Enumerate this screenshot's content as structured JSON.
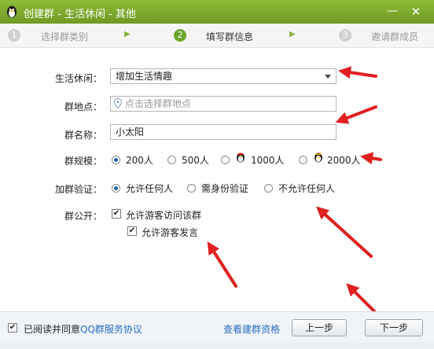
{
  "window": {
    "title": "创建群 - 生活休闲 - 其他",
    "minimize": "—",
    "close": "✕"
  },
  "steps": [
    {
      "num": "1",
      "label": "选择群类别"
    },
    {
      "num": "2",
      "label": "填写群信息"
    },
    {
      "num": "3",
      "label": "邀请群成员"
    }
  ],
  "form": {
    "category_label": "生活休闲：",
    "category_value": "增加生活情趣",
    "location_label": "群地点：",
    "location_placeholder": "点击选择群地点",
    "name_label": "群名称：",
    "name_value": "小太阳",
    "size_label": "群规模：",
    "size_options": [
      "200人",
      "500人",
      "1000人",
      "2000人"
    ],
    "verify_label": "加群验证：",
    "verify_options": [
      "允许任何人",
      "需身份验证",
      "不允许任何人"
    ],
    "public_label": "群公开：",
    "public_options": [
      "允许游客访问该群",
      "允许游客发言"
    ]
  },
  "footer": {
    "agree_text": "已阅读并同意",
    "agree_link": "QQ群服务协议",
    "qualification_link": "查看建群资格",
    "prev_button": "上一步",
    "next_button": "下一步"
  },
  "colors": {
    "title_bar": "#7aa72a",
    "annotation_red": "#e02020",
    "radio_selected": "#1c5fa8"
  }
}
